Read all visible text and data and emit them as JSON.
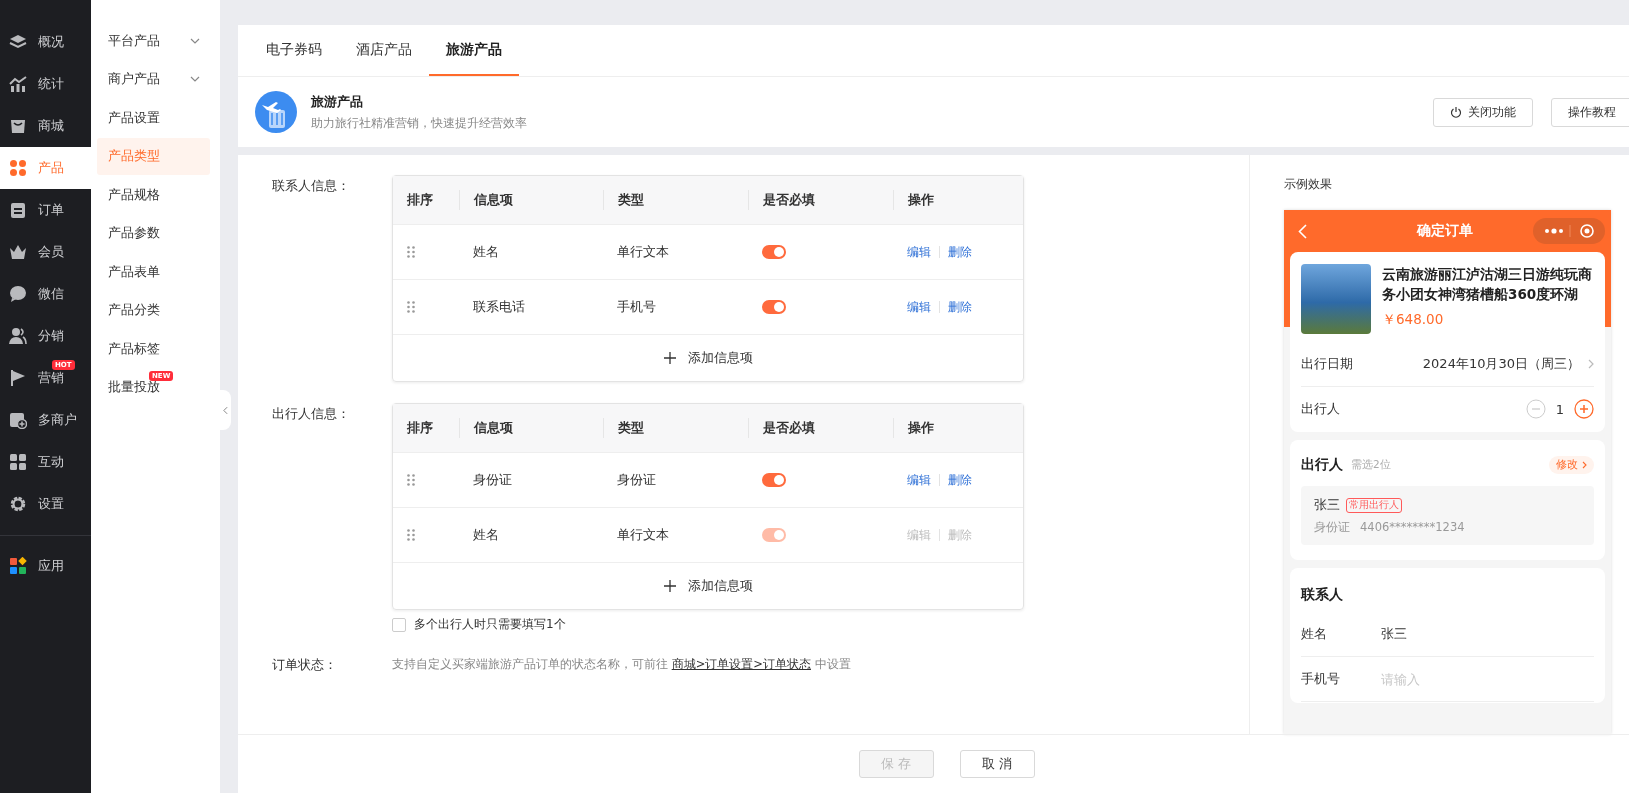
{
  "nav": {
    "items": [
      {
        "label": "概况",
        "selected": false
      },
      {
        "label": "统计",
        "selected": false
      },
      {
        "label": "商城",
        "selected": false
      },
      {
        "label": "产品",
        "selected": true
      },
      {
        "label": "订单",
        "selected": false
      },
      {
        "label": "会员",
        "selected": false
      },
      {
        "label": "微信",
        "selected": false
      },
      {
        "label": "分销",
        "selected": false
      },
      {
        "label": "营销",
        "selected": false,
        "badge": "HOT"
      },
      {
        "label": "多商户",
        "selected": false
      },
      {
        "label": "互动",
        "selected": false
      },
      {
        "label": "设置",
        "selected": false
      },
      {
        "label": "应用",
        "selected": false
      }
    ]
  },
  "submenu": {
    "items": [
      {
        "label": "平台产品",
        "selected": false,
        "expandable": true
      },
      {
        "label": "商户产品",
        "selected": false,
        "expandable": true
      },
      {
        "label": "产品设置",
        "selected": false,
        "expandable": false
      },
      {
        "label": "产品类型",
        "selected": true,
        "expandable": false
      },
      {
        "label": "产品规格",
        "selected": false,
        "expandable": false
      },
      {
        "label": "产品参数",
        "selected": false,
        "expandable": false
      },
      {
        "label": "产品表单",
        "selected": false,
        "expandable": false
      },
      {
        "label": "产品分类",
        "selected": false,
        "expandable": false
      },
      {
        "label": "产品标签",
        "selected": false,
        "expandable": false
      },
      {
        "label": "批量投放",
        "selected": false,
        "expandable": false,
        "badge": "NEW"
      }
    ]
  },
  "tabs": [
    {
      "label": "电子券码",
      "selected": false
    },
    {
      "label": "酒店产品",
      "selected": false
    },
    {
      "label": "旅游产品",
      "selected": true
    }
  ],
  "header": {
    "title": "旅游产品",
    "subtitle": "助力旅行社精准营销，快速提升经营效率",
    "buttons": [
      {
        "label": "关闭功能",
        "kind": "power"
      },
      {
        "label": "操作教程",
        "kind": "plain"
      }
    ]
  },
  "contact": {
    "label": "联系人信息：",
    "columns": [
      "排序",
      "信息项",
      "类型",
      "是否必填",
      "操作"
    ],
    "rows": [
      {
        "name": "姓名",
        "type": "单行文本",
        "required": true,
        "disabled": false,
        "actions": [
          "编辑",
          "删除"
        ]
      },
      {
        "name": "联系电话",
        "type": "手机号",
        "required": true,
        "disabled": false,
        "actions": [
          "编辑",
          "删除"
        ]
      }
    ],
    "add_label": "添加信息项"
  },
  "traveler": {
    "label": "出行人信息：",
    "columns": [
      "排序",
      "信息项",
      "类型",
      "是否必填",
      "操作"
    ],
    "rows": [
      {
        "name": "身份证",
        "type": "身份证",
        "required": true,
        "disabled": false,
        "actions": [
          "编辑",
          "删除"
        ]
      },
      {
        "name": "姓名",
        "type": "单行文本",
        "required": true,
        "disabled": true,
        "actions": [
          "编辑",
          "删除"
        ]
      }
    ],
    "add_label": "添加信息项",
    "option": {
      "label": "多个出行人时只需要填写1个",
      "checked": false
    }
  },
  "order_status": {
    "label": "订单状态：",
    "text": "支持自定义买家端旅游产品订单的状态名称，可前往",
    "link": "商城>订单设置>订单状态",
    "suffix": "中设置"
  },
  "preview": {
    "label": "示例效果",
    "phone": {
      "title": "确定订单",
      "product": {
        "title": "云南旅游丽江泸沽湖三日游纯玩商务小团女神湾猪槽船360度环湖",
        "price": "￥648.00"
      },
      "date": {
        "label": "出行日期",
        "value": "2024年10月30日（周三）"
      },
      "count": {
        "label": "出行人",
        "value": "1"
      },
      "travelers": {
        "title": "出行人",
        "hint": "需选2位",
        "edit": "修改",
        "items": [
          {
            "name": "张三",
            "tag": "常用出行人",
            "id_label": "身份证",
            "id_value": "4406********1234"
          }
        ]
      },
      "contact": {
        "title": "联系人",
        "fields": [
          {
            "label": "姓名",
            "value": "张三"
          },
          {
            "label": "手机号",
            "placeholder": "请输入"
          }
        ]
      }
    }
  },
  "footer": {
    "buttons": [
      {
        "label": "保 存",
        "disabled": true
      },
      {
        "label": "取 消",
        "disabled": false
      }
    ]
  }
}
